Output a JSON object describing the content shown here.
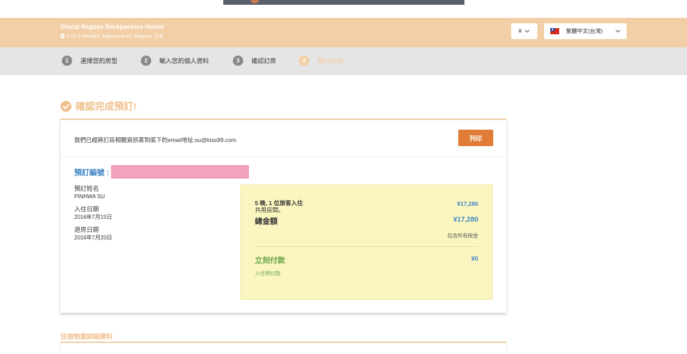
{
  "header": {
    "hotel_name": "Glocal Nagoya Backpackers Hostel",
    "hotel_address": "1-21-3 Noritake, Nakamura Ku, Nagoya, 日本",
    "currency": "¥",
    "language": "繁體中文(台灣)"
  },
  "steps": [
    {
      "number": "1",
      "label": "選擇您的房型"
    },
    {
      "number": "2",
      "label": "輸入您的個人資料"
    },
    {
      "number": "3",
      "label": "確認訂房"
    },
    {
      "number": "4",
      "label": "預訂完成!"
    }
  ],
  "confirmation": {
    "title": "確認完成預訂!",
    "email_notice": "我們已經將訂房相關資訊寄到底下的email地址:su@kiss99.com",
    "print_label": "列印",
    "booking_number_label": "預訂編號 :"
  },
  "guest": {
    "name_label": "預訂姓名",
    "name_value": "PINHWA SU",
    "checkin_label": "入住日期",
    "checkin_value": "2016年7月15日",
    "checkout_label": "退房日期",
    "checkout_value": "2016年7月20日"
  },
  "summary": {
    "stay_desc": "5 晚, 1 位旅客入住",
    "room_type": "共用房間。",
    "room_price": "¥17,280",
    "total_label": "總金額",
    "total_value": "¥17,280",
    "tax_note": "包含所有稅金",
    "pay_now_label": "立刻付款",
    "pay_now_value": "¥0",
    "pay_at_checkin": "入住時付款"
  },
  "property_section_title": "住宿物業詳細資料",
  "colors": {
    "header_bg": "#f2cfa6",
    "accent_blue": "#3f84c4",
    "print_orange": "#e07c35",
    "pay_green": "#6aa44a",
    "summary_bg": "#fbf6c0"
  }
}
